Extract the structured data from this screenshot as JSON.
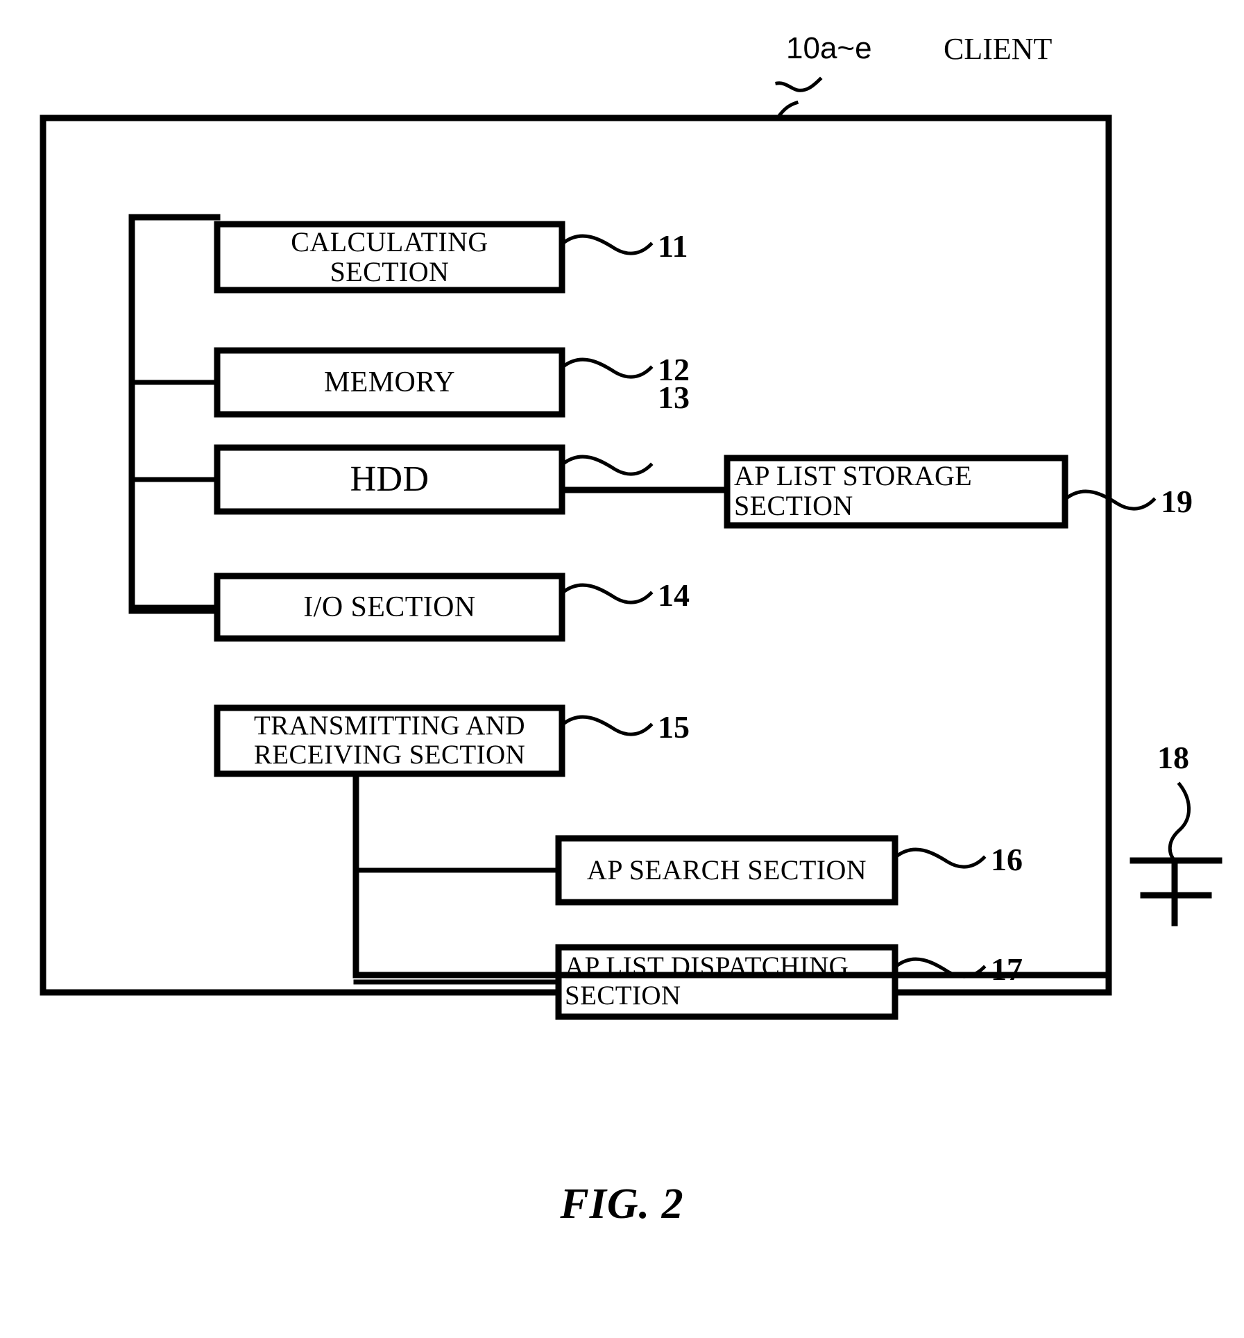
{
  "figure": {
    "caption": "FIG. 2",
    "header_ref": "10a~e",
    "header_title": "CLIENT"
  },
  "blocks": [
    {
      "id": "calculating-section",
      "label": "CALCULATING\nSECTION",
      "ref": "11",
      "align": "center"
    },
    {
      "id": "memory",
      "label": "MEMORY",
      "ref": "12",
      "align": "center"
    },
    {
      "id": "hdd",
      "label": "HDD",
      "ref": "13",
      "align": "center"
    },
    {
      "id": "io-section",
      "label": "I/O SECTION",
      "ref": "14",
      "align": "center"
    },
    {
      "id": "transmitting-receiving-section",
      "label": "TRANSMITTING AND\nRECEIVING SECTION",
      "ref": "15",
      "align": "center"
    },
    {
      "id": "ap-search-section",
      "label": "AP SEARCH SECTION",
      "ref": "16",
      "align": "center"
    },
    {
      "id": "ap-list-dispatching-section",
      "label": "AP LIST DISPATCHING\nSECTION",
      "ref": "17",
      "align": "left"
    },
    {
      "id": "ap-list-storage-section",
      "label": "AP LIST STORAGE\nSECTION",
      "ref": "19",
      "align": "left"
    }
  ],
  "network": {
    "ref": "18"
  },
  "colors": {
    "ink": "#000000",
    "paper": "#ffffff"
  }
}
